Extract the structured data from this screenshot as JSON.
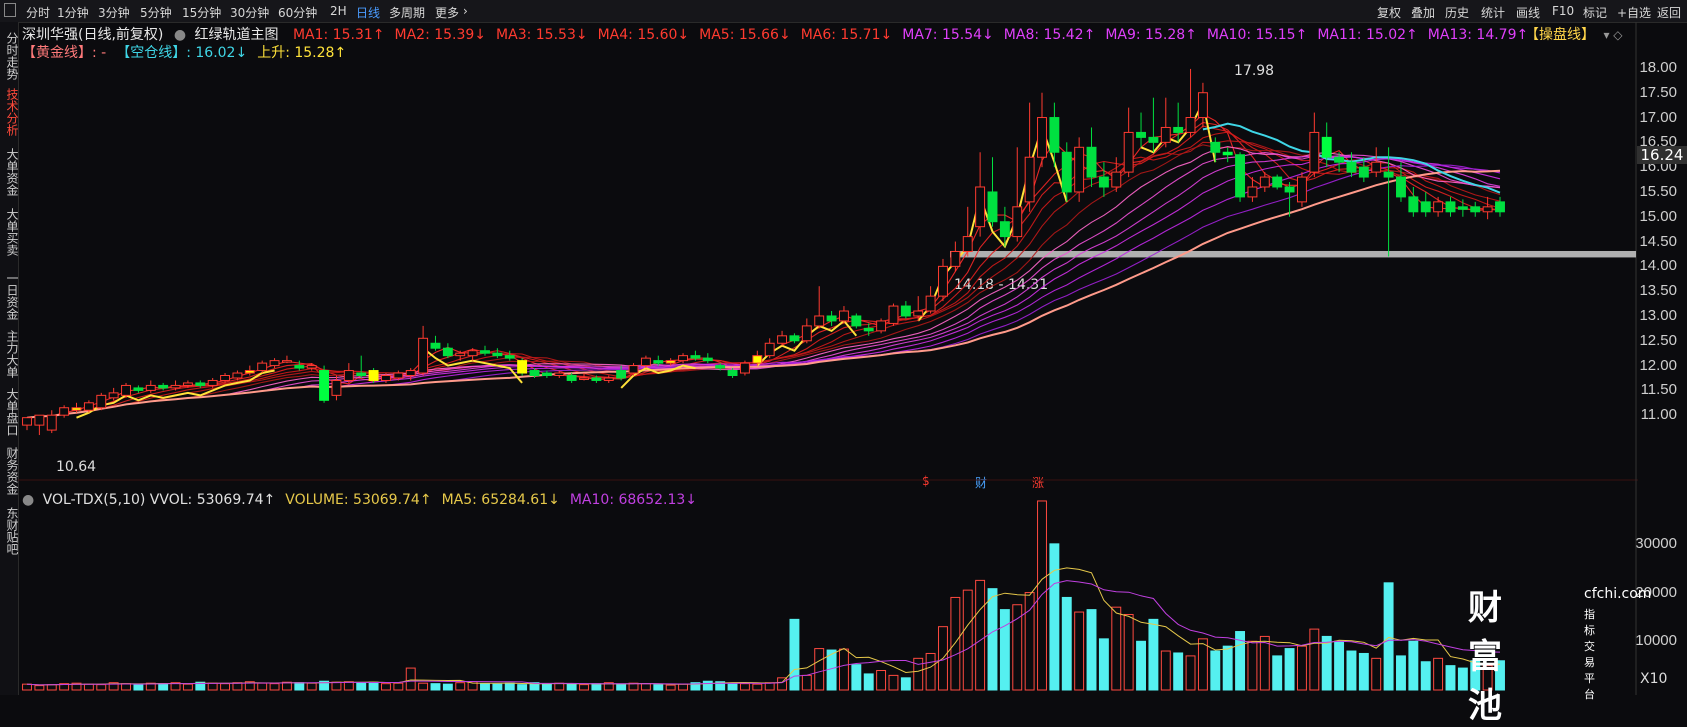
{
  "toolbar": {
    "periods": [
      "分时",
      "1分钟",
      "3分钟",
      "5分钟",
      "15分钟",
      "30分钟",
      "60分钟",
      "2H",
      "日线",
      "多周期",
      "更多"
    ],
    "active_period": "日线",
    "right_buttons": [
      "复权",
      "叠加",
      "历史",
      "统计",
      "画线",
      "F10",
      "标记",
      "+自选",
      "返回"
    ]
  },
  "sidebar": {
    "items": [
      "分时走势",
      "技术分析",
      "大单资金",
      "大单买卖",
      "一日资金",
      "主力大单",
      "大单盘口",
      "财务资金",
      "东财贴吧"
    ],
    "active": "技术分析"
  },
  "main_legend": {
    "stock": "深圳华强(日线,前复权)",
    "indicator": "红绿轨道主图",
    "ma": [
      {
        "label": "MA1: 15.31↑",
        "color": "#ff3b30"
      },
      {
        "label": "MA2: 15.39↓",
        "color": "#ff3b30"
      },
      {
        "label": "MA3: 15.53↓",
        "color": "#ff3b30"
      },
      {
        "label": "MA4: 15.60↓",
        "color": "#ff3b30"
      },
      {
        "label": "MA5: 15.66↓",
        "color": "#ff3b30"
      },
      {
        "label": "MA6: 15.71↓",
        "color": "#ff3b30"
      },
      {
        "label": "MA7: 15.54↓",
        "color": "#e040fb"
      },
      {
        "label": "MA8: 15.42↑",
        "color": "#e040fb"
      },
      {
        "label": "MA9: 15.28↑",
        "color": "#e040fb"
      },
      {
        "label": "MA10: 15.15↑",
        "color": "#e040fb"
      },
      {
        "label": "MA11: 15.02↑",
        "color": "#e040fb"
      },
      {
        "label": "MA13: 14.79↑",
        "color": "#e040fb"
      }
    ],
    "right_label": "【操盘线】",
    "right_icons": "▾ ◇",
    "line2": [
      {
        "label": "【黄金线】: -",
        "color": "#ff7a7a"
      },
      {
        "label": "【空仓线】: 16.02↓",
        "color": "#3fd6e6"
      },
      {
        "label": "上升: 15.28↑",
        "color": "#ffe23a"
      }
    ]
  },
  "price_axis": [
    "18.00",
    "17.50",
    "17.00",
    "16.50",
    "16.00",
    "15.50",
    "15.00",
    "14.50",
    "14.00",
    "13.50",
    "13.00",
    "12.50",
    "12.00",
    "11.50",
    "11.00"
  ],
  "current_price": "16.24",
  "annotations": {
    "high": "17.98",
    "low": "10.64",
    "support": "14.18 - 14.31",
    "markers": [
      "$",
      "财",
      "涨"
    ]
  },
  "vol_legend": [
    {
      "label": "VOL-TDX(5,10) VVOL: 53069.74↑",
      "color": "#e0e0e0"
    },
    {
      "label": "VOLUME: 53069.74↑",
      "color": "#e6c84a"
    },
    {
      "label": "MA5: 65284.61↓",
      "color": "#e6c84a"
    },
    {
      "label": "MA10: 68652.13↓",
      "color": "#c040e0"
    }
  ],
  "vol_axis": [
    "30000",
    "20000",
    "10000"
  ],
  "vol_unit": "X10",
  "watermark": {
    "brand": "财富池",
    "domain": "cfchi.com",
    "tagline": "指标交易平台"
  },
  "chart_data": {
    "type": "candlestick",
    "price_range": [
      10.5,
      18.2
    ],
    "candles": [
      [
        10.8,
        10.95,
        10.7,
        10.9
      ],
      [
        10.8,
        11.0,
        10.6,
        10.95
      ],
      [
        10.7,
        11.0,
        10.64,
        11.1
      ],
      [
        11.0,
        11.15,
        10.95,
        11.2
      ],
      [
        11.1,
        11.15,
        11.05,
        11.25
      ],
      [
        11.1,
        11.25,
        11.05,
        11.3
      ],
      [
        11.15,
        11.4,
        11.1,
        11.45
      ],
      [
        11.35,
        11.45,
        11.3,
        11.55
      ],
      [
        11.4,
        11.6,
        11.35,
        11.65
      ],
      [
        11.55,
        11.5,
        11.45,
        11.6
      ],
      [
        11.5,
        11.6,
        11.45,
        11.7
      ],
      [
        11.6,
        11.55,
        11.5,
        11.65
      ],
      [
        11.55,
        11.6,
        11.5,
        11.7
      ],
      [
        11.6,
        11.65,
        11.55,
        11.7
      ],
      [
        11.65,
        11.6,
        11.55,
        11.7
      ],
      [
        11.6,
        11.7,
        11.55,
        11.75
      ],
      [
        11.7,
        11.8,
        11.65,
        11.85
      ],
      [
        11.75,
        11.85,
        11.7,
        11.9
      ],
      [
        11.85,
        11.9,
        11.8,
        12.0
      ],
      [
        11.9,
        12.05,
        11.85,
        12.1
      ],
      [
        12.0,
        12.1,
        11.95,
        12.15
      ],
      [
        12.1,
        12.1,
        12.05,
        12.2
      ],
      [
        12.0,
        11.95,
        11.9,
        12.1
      ],
      [
        11.95,
        12.0,
        11.9,
        12.05
      ],
      [
        11.9,
        11.3,
        11.25,
        12.0
      ],
      [
        11.4,
        11.7,
        11.3,
        11.8
      ],
      [
        11.7,
        11.9,
        11.65,
        12.05
      ],
      [
        11.85,
        11.8,
        11.75,
        12.2
      ],
      [
        11.9,
        11.7,
        11.65,
        11.95
      ],
      [
        11.7,
        11.8,
        11.65,
        11.85
      ],
      [
        11.75,
        11.85,
        11.7,
        11.9
      ],
      [
        11.8,
        11.9,
        11.7,
        11.95
      ],
      [
        11.85,
        12.55,
        11.8,
        12.8
      ],
      [
        12.45,
        12.35,
        12.3,
        12.6
      ],
      [
        12.35,
        12.2,
        12.15,
        12.45
      ],
      [
        12.2,
        12.25,
        12.1,
        12.3
      ],
      [
        12.2,
        12.3,
        12.1,
        12.35
      ],
      [
        12.3,
        12.25,
        12.2,
        12.4
      ],
      [
        12.25,
        12.2,
        12.15,
        12.35
      ],
      [
        12.2,
        12.15,
        12.1,
        12.3
      ],
      [
        12.1,
        11.85,
        11.8,
        12.15
      ],
      [
        11.9,
        11.8,
        11.75,
        11.95
      ],
      [
        11.85,
        11.8,
        11.75,
        11.9
      ],
      [
        11.8,
        11.85,
        11.75,
        11.9
      ],
      [
        11.8,
        11.7,
        11.65,
        11.85
      ],
      [
        11.75,
        11.75,
        11.7,
        11.85
      ],
      [
        11.75,
        11.7,
        11.65,
        11.8
      ],
      [
        11.7,
        11.75,
        11.65,
        11.8
      ],
      [
        11.9,
        11.75,
        11.7,
        12.0
      ],
      [
        11.85,
        12.0,
        11.8,
        12.05
      ],
      [
        12.0,
        12.15,
        11.95,
        12.2
      ],
      [
        12.1,
        12.05,
        12.0,
        12.2
      ],
      [
        12.05,
        12.1,
        12.0,
        12.15
      ],
      [
        12.1,
        12.2,
        12.05,
        12.25
      ],
      [
        12.2,
        12.15,
        12.1,
        12.3
      ],
      [
        12.15,
        12.1,
        12.05,
        12.25
      ],
      [
        12.0,
        11.95,
        11.9,
        12.05
      ],
      [
        11.9,
        11.8,
        11.75,
        11.95
      ],
      [
        11.85,
        12.05,
        11.8,
        12.1
      ],
      [
        12.05,
        12.2,
        12.0,
        12.3
      ],
      [
        12.2,
        12.45,
        12.15,
        12.55
      ],
      [
        12.45,
        12.6,
        12.4,
        12.7
      ],
      [
        12.6,
        12.5,
        12.45,
        12.65
      ],
      [
        12.5,
        12.8,
        12.45,
        12.95
      ],
      [
        12.8,
        13.0,
        12.75,
        13.6
      ],
      [
        13.0,
        12.9,
        12.8,
        13.1
      ],
      [
        12.9,
        13.1,
        12.85,
        13.2
      ],
      [
        13.0,
        12.8,
        12.75,
        13.05
      ],
      [
        12.75,
        12.7,
        12.6,
        12.85
      ],
      [
        12.7,
        12.9,
        12.65,
        12.95
      ],
      [
        12.85,
        13.2,
        12.8,
        13.25
      ],
      [
        13.2,
        13.0,
        12.95,
        13.3
      ],
      [
        13.0,
        13.1,
        12.9,
        13.4
      ],
      [
        13.1,
        13.4,
        13.05,
        13.6
      ],
      [
        13.4,
        14.0,
        13.3,
        14.15
      ],
      [
        14.0,
        14.3,
        13.9,
        14.5
      ],
      [
        14.3,
        14.6,
        14.2,
        15.2
      ],
      [
        14.8,
        15.6,
        14.6,
        16.3
      ],
      [
        15.5,
        14.9,
        14.8,
        16.2
      ],
      [
        14.9,
        14.6,
        14.4,
        15.2
      ],
      [
        14.6,
        15.2,
        14.5,
        16.4
      ],
      [
        15.3,
        16.2,
        15.1,
        17.3
      ],
      [
        16.2,
        17.0,
        16.0,
        17.5
      ],
      [
        17.0,
        16.3,
        16.0,
        17.3
      ],
      [
        16.3,
        15.5,
        15.3,
        16.5
      ],
      [
        15.5,
        16.4,
        15.3,
        16.6
      ],
      [
        16.4,
        15.8,
        15.6,
        16.8
      ],
      [
        15.8,
        15.6,
        15.4,
        16.1
      ],
      [
        15.6,
        15.9,
        15.5,
        16.2
      ],
      [
        15.9,
        16.7,
        15.8,
        17.2
      ],
      [
        16.7,
        16.6,
        16.4,
        17.1
      ],
      [
        16.6,
        16.5,
        16.3,
        17.4
      ],
      [
        16.5,
        16.8,
        16.4,
        17.4
      ],
      [
        16.8,
        16.7,
        16.5,
        17.3
      ],
      [
        16.7,
        17.0,
        16.6,
        17.98
      ],
      [
        17.0,
        17.5,
        16.8,
        17.7
      ],
      [
        16.5,
        16.3,
        16.1,
        16.6
      ],
      [
        16.3,
        16.25,
        16.1,
        16.4
      ],
      [
        16.25,
        15.4,
        15.3,
        16.3
      ],
      [
        15.4,
        15.6,
        15.3,
        15.8
      ],
      [
        15.6,
        15.8,
        15.5,
        15.9
      ],
      [
        15.8,
        15.6,
        15.55,
        15.85
      ],
      [
        15.6,
        15.5,
        15.0,
        15.7
      ],
      [
        15.3,
        15.8,
        15.2,
        15.9
      ],
      [
        15.9,
        16.7,
        15.8,
        17.1
      ],
      [
        16.6,
        16.2,
        16.0,
        16.9
      ],
      [
        16.2,
        16.1,
        15.9,
        16.3
      ],
      [
        16.1,
        15.9,
        15.8,
        16.3
      ],
      [
        16.0,
        15.8,
        15.7,
        16.2
      ],
      [
        15.9,
        16.1,
        15.8,
        16.4
      ],
      [
        15.9,
        15.8,
        14.2,
        16.4
      ],
      [
        15.8,
        15.4,
        15.3,
        16.1
      ],
      [
        15.4,
        15.1,
        15.0,
        15.6
      ],
      [
        15.3,
        15.1,
        15.0,
        15.5
      ],
      [
        15.1,
        15.3,
        15.0,
        15.4
      ],
      [
        15.3,
        15.1,
        15.0,
        15.4
      ],
      [
        15.2,
        15.15,
        15.0,
        15.35
      ],
      [
        15.2,
        15.1,
        15.0,
        15.3
      ],
      [
        15.1,
        15.2,
        14.95,
        15.4
      ],
      [
        15.3,
        15.1,
        15.0,
        15.4
      ]
    ],
    "support_band": [
      14.18,
      14.31
    ],
    "volume_range": [
      0,
      39000
    ],
    "volume": [
      1200,
      900,
      1100,
      1300,
      1400,
      1200,
      1100,
      1500,
      1300,
      1200,
      1400,
      1300,
      1500,
      1200,
      1600,
      1400,
      1300,
      1500,
      1700,
      1400,
      1300,
      1600,
      1500,
      1400,
      1800,
      1600,
      1700,
      1500,
      1600,
      1300,
      1400,
      4500,
      1400,
      1300,
      1200,
      1500,
      1700,
      1300,
      1200,
      1400,
      1100,
      1500,
      1300,
      1400,
      1200,
      1100,
      1300,
      1500,
      1200,
      1400,
      1300,
      1100,
      1000,
      1200,
      1500,
      1800,
      1700,
      1400,
      1300,
      1200,
      1500,
      2500,
      14500,
      3000,
      8500,
      8200,
      8400,
      5200,
      3300,
      4000,
      3000,
      2500,
      6500,
      7500,
      13000,
      19000,
      20500,
      22500,
      20800,
      16500,
      17500,
      20000,
      38800,
      30000,
      19000,
      16000,
      16500,
      10500,
      17000,
      15500,
      10000,
      14500,
      8000,
      7600,
      7000,
      10500,
      8000,
      9000,
      12000,
      10000,
      11000,
      7000,
      8500,
      9000,
      12500,
      11000,
      10000,
      8000,
      7500,
      6500,
      22000,
      7000,
      10000,
      5800,
      6500,
      5000,
      4500,
      6000,
      5000,
      6000,
      4000,
      4500,
      5300
    ]
  }
}
